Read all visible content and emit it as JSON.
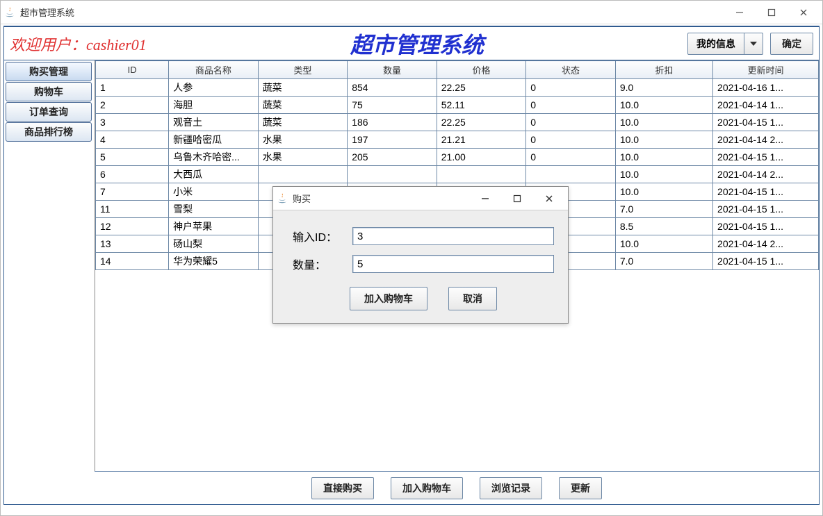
{
  "window": {
    "title": "超市管理系统"
  },
  "header": {
    "welcome_prefix": "欢迎用户：",
    "username": "cashier01",
    "system_title": "超市管理系统",
    "dropdown_label": "我的信息",
    "confirm_label": "确定"
  },
  "sidebar": {
    "tabs": [
      {
        "label": "购买管理",
        "active": true
      },
      {
        "label": "购物车",
        "active": false
      },
      {
        "label": "订单查询",
        "active": false
      },
      {
        "label": "商品排行榜",
        "active": false
      }
    ]
  },
  "table": {
    "headers": [
      "ID",
      "商品名称",
      "类型",
      "数量",
      "价格",
      "状态",
      "折扣",
      "更新时间"
    ],
    "rows": [
      [
        "1",
        "人参",
        "蔬菜",
        "854",
        "22.25",
        "0",
        "9.0",
        "2021-04-16 1..."
      ],
      [
        "2",
        "海胆",
        "蔬菜",
        "75",
        "52.11",
        "0",
        "10.0",
        "2021-04-14 1..."
      ],
      [
        "3",
        "观音土",
        "蔬菜",
        "186",
        "22.25",
        "0",
        "10.0",
        "2021-04-15 1..."
      ],
      [
        "4",
        "新疆哈密瓜",
        "水果",
        "197",
        "21.21",
        "0",
        "10.0",
        "2021-04-14 2..."
      ],
      [
        "5",
        "乌鲁木齐哈密...",
        "水果",
        "205",
        "21.00",
        "0",
        "10.0",
        "2021-04-15 1..."
      ],
      [
        "6",
        "大西瓜",
        "",
        "",
        "",
        "",
        "10.0",
        "2021-04-14 2..."
      ],
      [
        "7",
        "小米",
        "",
        "",
        "",
        "",
        "10.0",
        "2021-04-15 1..."
      ],
      [
        "11",
        "雪梨",
        "",
        "",
        "",
        "",
        "7.0",
        "2021-04-15 1..."
      ],
      [
        "12",
        "神户苹果",
        "",
        "",
        "",
        "",
        "8.5",
        "2021-04-15 1..."
      ],
      [
        "13",
        "砀山梨",
        "",
        "",
        "",
        "",
        "10.0",
        "2021-04-14 2..."
      ],
      [
        "14",
        "华为荣耀5",
        "",
        "",
        "",
        "",
        "7.0",
        "2021-04-15 1..."
      ]
    ]
  },
  "bottom_buttons": [
    "直接购买",
    "加入购物车",
    "浏览记录",
    "更新"
  ],
  "dialog": {
    "title": "购买",
    "id_label": "输入ID：",
    "id_value": "3",
    "qty_label": "数量：",
    "qty_value": "5",
    "add_label": "加入购物车",
    "cancel_label": "取消"
  }
}
